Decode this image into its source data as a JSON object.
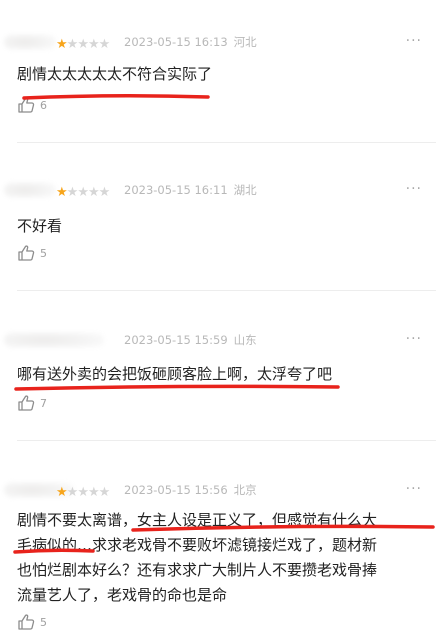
{
  "reviews": [
    {
      "stars": 1,
      "date": "2023-05-15 16:13",
      "location": "河北",
      "more_icon": "···",
      "text": "剧情太太太太太不符合实际了",
      "likes": "6"
    },
    {
      "stars": 1,
      "date": "2023-05-15 16:11",
      "location": "湖北",
      "more_icon": "···",
      "text": "不好看",
      "likes": "5"
    },
    {
      "stars": 1,
      "date": "2023-05-15 15:59",
      "location": "山东",
      "more_icon": "···",
      "text": "哪有送外卖的会把饭砸顾客脸上啊，太浮夸了吧",
      "likes": "7"
    },
    {
      "stars": 1,
      "date": "2023-05-15 15:56",
      "location": "北京",
      "more_icon": "···",
      "text": "剧情不要太离谱，女主人设是正义了，但感觉有什么大\n毛病似的…求求老戏骨不要败坏滤镜接烂戏了，题材新\n也怕烂剧本好么？还有求求广大制片人不要攒老戏骨捧\n流量艺人了，老戏骨的命也是命",
      "likes": "5"
    }
  ],
  "colors": {
    "star_on": "#f7a51c",
    "star_off": "#d6d6d6",
    "annotation": "#e8231c"
  },
  "icons": [
    "star-icon",
    "more-icon",
    "thumbs-up-icon"
  ]
}
